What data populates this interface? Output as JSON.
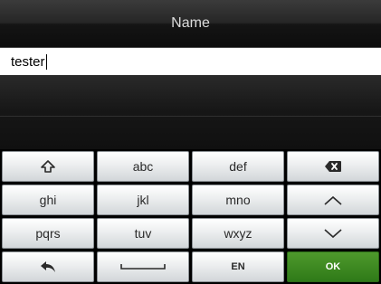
{
  "header": {
    "title": "Name"
  },
  "input": {
    "value": "tester"
  },
  "keypad": {
    "abc": "abc",
    "def": "def",
    "ghi": "ghi",
    "jkl": "jkl",
    "mno": "mno",
    "pqrs": "pqrs",
    "tuv": "tuv",
    "wxyz": "wxyz",
    "lang": "EN",
    "ok": "OK",
    "icons": {
      "shift": "shift-icon",
      "backspace": "backspace-icon",
      "up": "chevron-up-icon",
      "down": "chevron-down-icon",
      "back": "back-arrow-icon",
      "space": "space-bar-icon"
    }
  },
  "colors": {
    "ok_key": "#3f8a22",
    "title_bar": "#262626",
    "key_face": "#eceeef"
  }
}
